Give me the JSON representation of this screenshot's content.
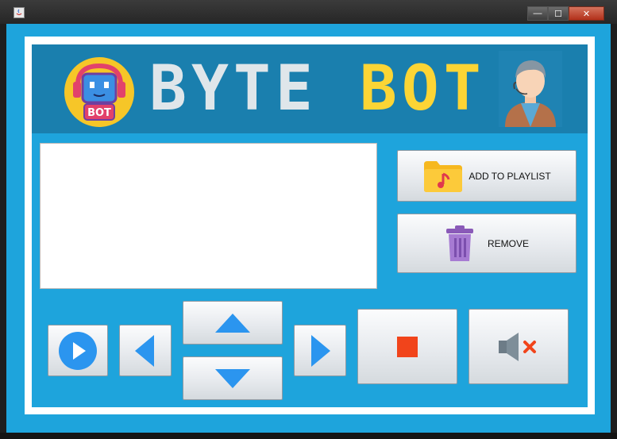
{
  "window": {
    "title": "",
    "controls": {
      "minimize": "—",
      "maximize": "☐",
      "close": "✕"
    }
  },
  "banner": {
    "title_part1": "BYTE",
    "title_part2": "BOT",
    "logo_badge": "BOT",
    "colors": {
      "title_white": "#dfe6ea",
      "title_yellow": "#fcd535",
      "banner_bg": "#1a7fae",
      "panel_bg": "#1ea4dc"
    }
  },
  "playlist": {
    "value": ""
  },
  "buttons": {
    "add_to_playlist": "ADD TO PLAYLIST",
    "remove": "REMOVE"
  },
  "icons": {
    "folder": "folder-music-icon",
    "trash": "trash-icon",
    "play": "play-icon",
    "previous": "arrow-left-icon",
    "volume_up": "arrow-up-icon",
    "volume_down": "arrow-down-icon",
    "next": "arrow-right-icon",
    "stop": "stop-icon",
    "mute": "speaker-mute-icon"
  }
}
